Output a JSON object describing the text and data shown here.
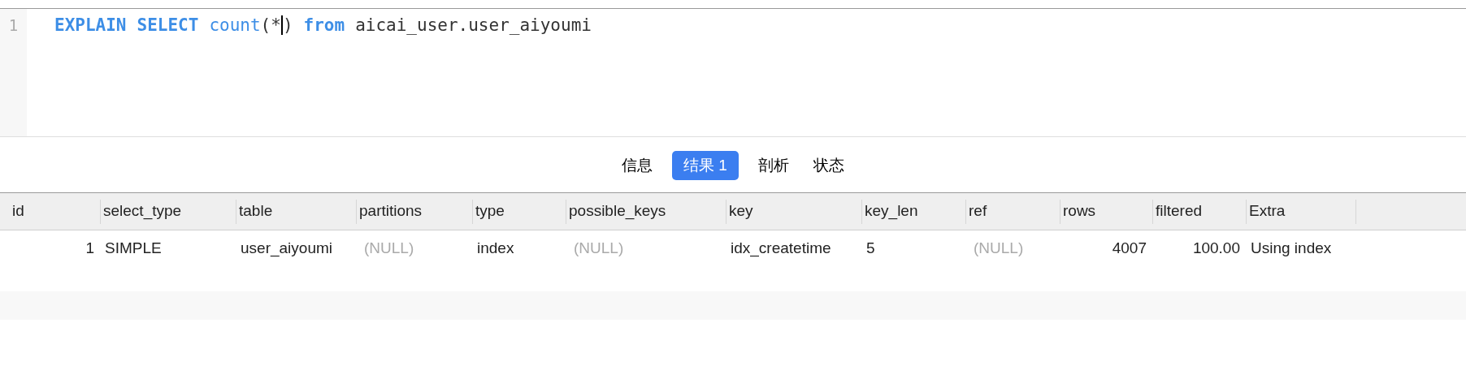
{
  "editor": {
    "lines": [
      {
        "number": "1",
        "tokens": [
          {
            "kind": "keyword",
            "text": "EXPLAIN"
          },
          {
            "kind": "keyword",
            "text": "SELECT"
          },
          {
            "kind": "function",
            "text": "count"
          },
          {
            "kind": "plain",
            "text": "(*",
            "caret": true,
            "join": true
          },
          {
            "kind": "plain",
            "text": ")",
            "join": true
          },
          {
            "kind": "keyword",
            "text": "from"
          },
          {
            "kind": "plain",
            "text": "aicai_user.user_aiyoumi"
          }
        ]
      }
    ]
  },
  "tabs": [
    {
      "label": "信息",
      "selected": false
    },
    {
      "label": "结果 1",
      "selected": true
    },
    {
      "label": "剖析",
      "selected": false
    },
    {
      "label": "状态",
      "selected": false
    }
  ],
  "table": {
    "columns": [
      "id",
      "select_type",
      "table",
      "partitions",
      "type",
      "possible_keys",
      "key",
      "key_len",
      "ref",
      "rows",
      "filtered",
      "Extra"
    ],
    "rows": [
      [
        {
          "kind": "number",
          "text": "1"
        },
        {
          "kind": "text",
          "text": "SIMPLE"
        },
        {
          "kind": "text",
          "text": "user_aiyoumi"
        },
        {
          "kind": "null",
          "text": "(NULL)"
        },
        {
          "kind": "text",
          "text": "index"
        },
        {
          "kind": "null",
          "text": "(NULL)"
        },
        {
          "kind": "text",
          "text": "idx_createtime"
        },
        {
          "kind": "text",
          "text": "5"
        },
        {
          "kind": "null",
          "text": "(NULL)"
        },
        {
          "kind": "number",
          "text": "4007"
        },
        {
          "kind": "number",
          "text": "100.00"
        },
        {
          "kind": "text",
          "text": "Using index"
        }
      ]
    ]
  }
}
